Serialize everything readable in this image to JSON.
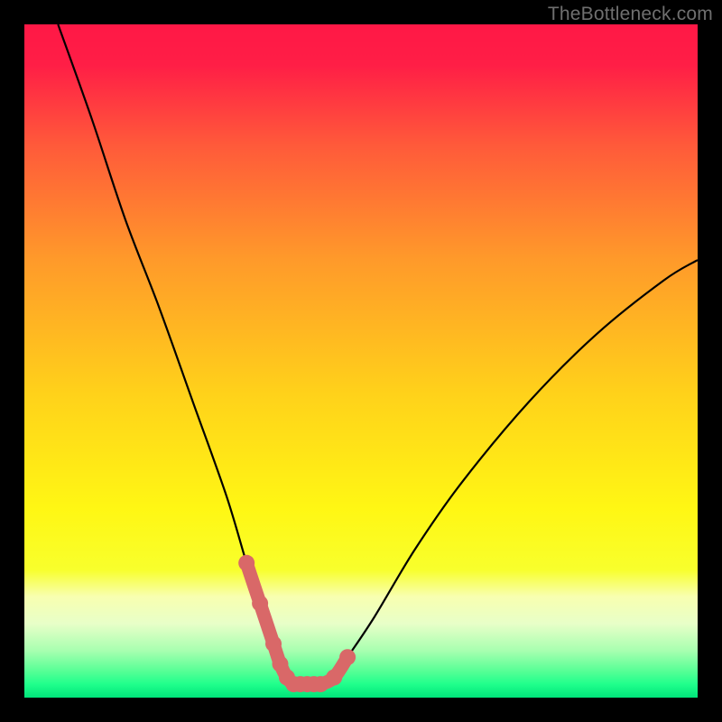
{
  "watermark": {
    "text": "TheBottleneck.com"
  },
  "colors": {
    "frame": "#000000",
    "curve_line": "#000000",
    "highlight_fill": "#d96868",
    "gradient_stops": [
      {
        "pct": 0,
        "color": "#ff1846"
      },
      {
        "pct": 6,
        "color": "#ff1e46"
      },
      {
        "pct": 18,
        "color": "#ff5a3a"
      },
      {
        "pct": 35,
        "color": "#ff9a2a"
      },
      {
        "pct": 55,
        "color": "#ffd21a"
      },
      {
        "pct": 72,
        "color": "#fff714"
      },
      {
        "pct": 81,
        "color": "#f8ff2c"
      },
      {
        "pct": 85,
        "color": "#f8ffb0"
      },
      {
        "pct": 89,
        "color": "#e8ffc8"
      },
      {
        "pct": 93,
        "color": "#a8ffb0"
      },
      {
        "pct": 96,
        "color": "#58ff96"
      },
      {
        "pct": 98,
        "color": "#20ff8c"
      },
      {
        "pct": 100,
        "color": "#00e47a"
      }
    ]
  },
  "chart_data": {
    "type": "line",
    "title": "",
    "xlabel": "",
    "ylabel": "",
    "xlim": [
      0,
      100
    ],
    "ylim": [
      0,
      100
    ],
    "legend": false,
    "grid": false,
    "annotations": [
      "TheBottleneck.com"
    ],
    "series": [
      {
        "name": "bottleneck-curve",
        "x": [
          5,
          10,
          15,
          20,
          25,
          30,
          33,
          35,
          37,
          38,
          39,
          40,
          41,
          42,
          43,
          44,
          46,
          48,
          52,
          58,
          65,
          75,
          85,
          95,
          100
        ],
        "y": [
          100,
          86,
          71,
          58,
          44,
          30,
          20,
          14,
          8,
          5,
          3,
          2,
          2,
          2,
          2,
          2,
          3,
          6,
          12,
          22,
          32,
          44,
          54,
          62,
          65
        ]
      }
    ],
    "highlight": {
      "name": "optimal-range",
      "x": [
        33,
        35,
        37,
        38,
        39,
        40,
        41,
        42,
        43,
        44,
        46,
        48
      ],
      "y": [
        20,
        14,
        8,
        5,
        3,
        2,
        2,
        2,
        2,
        2,
        3,
        6
      ]
    }
  }
}
